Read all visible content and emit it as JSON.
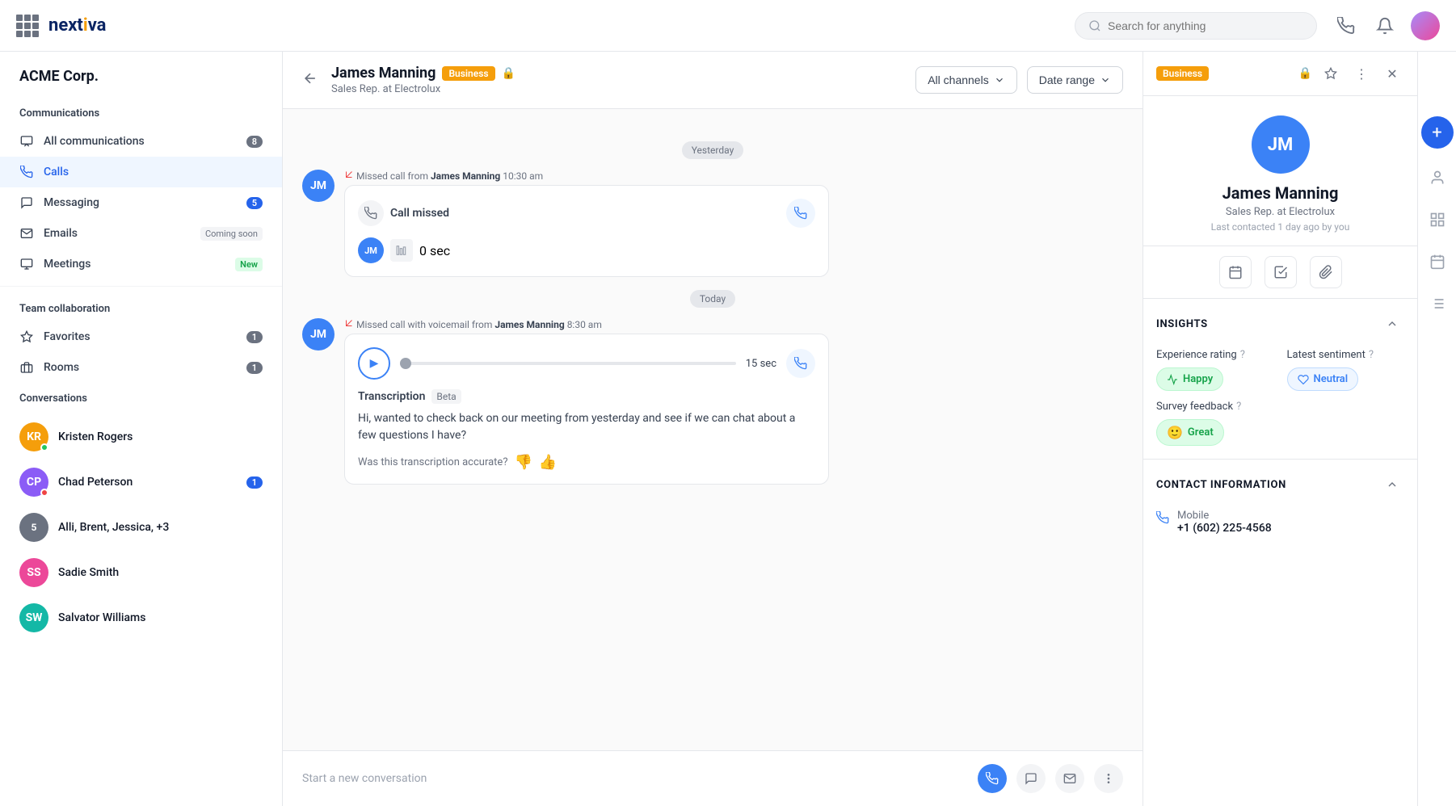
{
  "app": {
    "logo_text": "nextiva",
    "grid_icon": "grid-icon"
  },
  "nav": {
    "search_placeholder": "Search for anything",
    "phone_icon": "phone-icon",
    "bell_icon": "bell-icon",
    "avatar_icon": "user-avatar"
  },
  "sidebar": {
    "company": "ACME Corp.",
    "communications_title": "Communications",
    "items": [
      {
        "id": "all-communications",
        "label": "All communications",
        "icon": "inbox-icon",
        "badge": "8"
      },
      {
        "id": "calls",
        "label": "Calls",
        "icon": "phone-icon",
        "badge": null,
        "active": true
      },
      {
        "id": "messaging",
        "label": "Messaging",
        "icon": "chat-icon",
        "badge": "5"
      },
      {
        "id": "emails",
        "label": "Emails",
        "icon": "email-icon",
        "tag": "Coming soon"
      },
      {
        "id": "meetings",
        "label": "Meetings",
        "icon": "video-icon",
        "tag": "New"
      }
    ],
    "team_title": "Team collaboration",
    "team_items": [
      {
        "id": "favorites",
        "label": "Favorites",
        "icon": "star-icon",
        "badge": "1"
      },
      {
        "id": "rooms",
        "label": "Rooms",
        "icon": "building-icon",
        "badge": "1"
      }
    ],
    "conversations_title": "Conversations",
    "conversations": [
      {
        "id": "kristen-rogers",
        "name": "Kristen Rogers",
        "avatar_color": "#f59e0b",
        "initials": "KR",
        "badge": null,
        "online": true
      },
      {
        "id": "chad-peterson",
        "name": "Chad Peterson",
        "avatar_color": "#8b5cf6",
        "initials": "CP",
        "badge": "1",
        "online": false
      },
      {
        "id": "alli-brent",
        "name": "Alli, Brent, Jessica, +3",
        "avatar_color": "#6b7280",
        "initials": "5",
        "badge": null,
        "online": false
      },
      {
        "id": "sadie-smith",
        "name": "Sadie Smith",
        "avatar_color": "#ec4899",
        "initials": "SS",
        "badge": null,
        "online": false
      },
      {
        "id": "salvator-williams",
        "name": "Salvator Williams",
        "avatar_color": "#14b8a6",
        "initials": "SW",
        "badge": null,
        "online": false
      }
    ]
  },
  "chat": {
    "back_label": "←",
    "contact_name": "James Manning",
    "contact_tag": "Business",
    "contact_title": "Sales Rep. at Electrolux",
    "all_channels_label": "All channels",
    "date_range_label": "Date range",
    "messages": {
      "yesterday_label": "Yesterday",
      "today_label": "Today",
      "missed_call_1": {
        "avatar_initials": "JM",
        "avatar_color": "#3b82f6",
        "header": "Missed call from",
        "contact": "James Manning",
        "time": "10:30 am",
        "call_status": "Call missed",
        "duration": "0 sec"
      },
      "missed_call_2": {
        "avatar_initials": "JM",
        "avatar_color": "#3b82f6",
        "header": "Missed call with voicemail from",
        "contact": "James Manning",
        "time": "8:30 am",
        "voicemail_duration": "15 sec",
        "transcription_label": "Transcription",
        "transcription_badge": "Beta",
        "transcription_text": "Hi, wanted to check back on our meeting from yesterday and see if we can chat about a few questions I have?",
        "feedback_question": "Was this transcription accurate?"
      }
    },
    "footer": {
      "placeholder": "Start a new conversation",
      "phone_icon": "phone-icon",
      "message_icon": "message-icon",
      "email_icon": "email-icon",
      "more_icon": "more-icon"
    }
  },
  "right_panel": {
    "tag": "Business",
    "avatar_initials": "JM",
    "avatar_color": "#3b82f6",
    "name": "James Manning",
    "title": "Sales Rep. at Electrolux",
    "last_contact": "Last contacted 1 day ago by you",
    "actions": [
      "calendar-icon",
      "task-icon",
      "attachment-icon"
    ],
    "insights": {
      "title": "INSIGHTS",
      "experience_rating_label": "Experience rating",
      "experience_help": "?",
      "experience_value": "Happy",
      "latest_sentiment_label": "Latest sentiment",
      "sentiment_help": "?",
      "sentiment_value": "Neutral",
      "survey_feedback_label": "Survey feedback",
      "survey_help": "?",
      "survey_value": "Great"
    },
    "contact_info": {
      "title": "CONTACT INFORMATION",
      "mobile_label": "Mobile",
      "mobile_value": "+1 (602) 225-4568"
    }
  }
}
